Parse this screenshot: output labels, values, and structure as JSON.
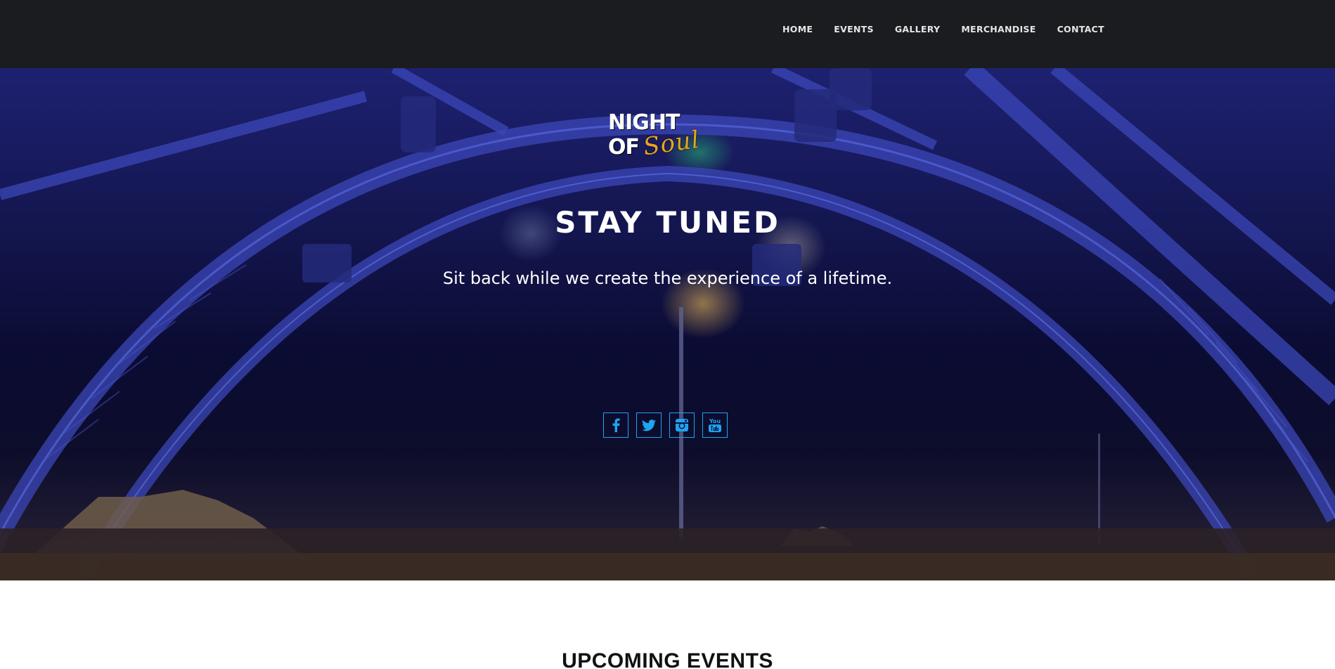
{
  "nav": {
    "items": [
      {
        "label": "HOME"
      },
      {
        "label": "EVENTS"
      },
      {
        "label": "GALLERY"
      },
      {
        "label": "MERCHANDISE"
      },
      {
        "label": "CONTACT"
      }
    ]
  },
  "logo": {
    "line1": "NIGHT OF",
    "line2": "Soul"
  },
  "hero": {
    "title": "STAY TUNED",
    "subtitle": "Sit back while we create the experience of a lifetime."
  },
  "social": [
    {
      "icon": "facebook-icon"
    },
    {
      "icon": "twitter-icon"
    },
    {
      "icon": "instagram-icon"
    },
    {
      "icon": "youtube-icon",
      "label": "You"
    }
  ],
  "section": {
    "title": "UPCOMING EVENTS"
  },
  "colors": {
    "nav_bg": "#1b1c20",
    "accent_social": "#1ea4f0",
    "logo_gold": "#e7a51d"
  }
}
